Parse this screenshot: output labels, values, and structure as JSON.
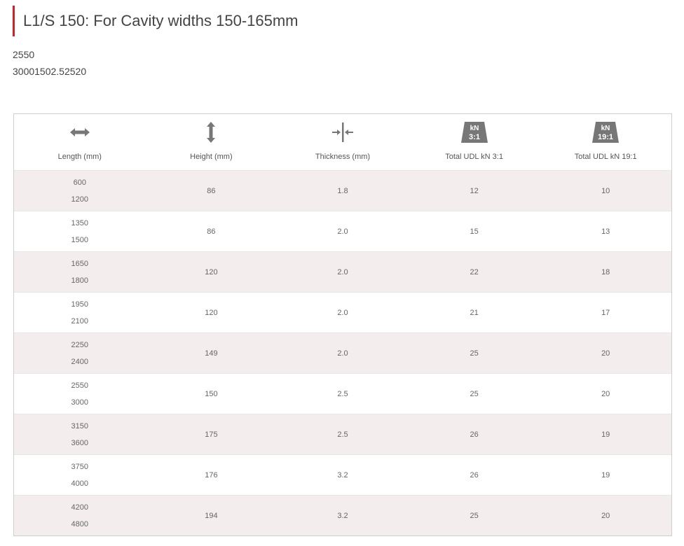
{
  "header": {
    "title": "L1/S 150: For Cavity widths 150-165mm",
    "meta_line_1": "2550",
    "meta_line_2": "30001502.52520"
  },
  "table": {
    "columns": [
      {
        "label": "Length (mm)",
        "icon": "horizontal-arrows-icon"
      },
      {
        "label": "Height (mm)",
        "icon": "vertical-arrows-icon"
      },
      {
        "label": "Thickness (mm)",
        "icon": "thickness-icon"
      },
      {
        "label": "Total UDL kN 3:1",
        "icon": "load-badge-icon",
        "badge_top": "kN",
        "badge_bottom": "3:1"
      },
      {
        "label": "Total UDL kN 19:1",
        "icon": "load-badge-icon",
        "badge_top": "kN",
        "badge_bottom": "19:1"
      }
    ],
    "rows": [
      {
        "length_a": "600",
        "length_b": "1200",
        "height": "86",
        "thickness": "1.8",
        "udl_3_1": "12",
        "udl_19_1": "10"
      },
      {
        "length_a": "1350",
        "length_b": "1500",
        "height": "86",
        "thickness": "2.0",
        "udl_3_1": "15",
        "udl_19_1": "13"
      },
      {
        "length_a": "1650",
        "length_b": "1800",
        "height": "120",
        "thickness": "2.0",
        "udl_3_1": "22",
        "udl_19_1": "18"
      },
      {
        "length_a": "1950",
        "length_b": "2100",
        "height": "120",
        "thickness": "2.0",
        "udl_3_1": "21",
        "udl_19_1": "17"
      },
      {
        "length_a": "2250",
        "length_b": "2400",
        "height": "149",
        "thickness": "2.0",
        "udl_3_1": "25",
        "udl_19_1": "20"
      },
      {
        "length_a": "2550",
        "length_b": "3000",
        "height": "150",
        "thickness": "2.5",
        "udl_3_1": "25",
        "udl_19_1": "20"
      },
      {
        "length_a": "3150",
        "length_b": "3600",
        "height": "175",
        "thickness": "2.5",
        "udl_3_1": "26",
        "udl_19_1": "19"
      },
      {
        "length_a": "3750",
        "length_b": "4000",
        "height": "176",
        "thickness": "3.2",
        "udl_3_1": "26",
        "udl_19_1": "19"
      },
      {
        "length_a": "4200",
        "length_b": "4800",
        "height": "194",
        "thickness": "3.2",
        "udl_3_1": "25",
        "udl_19_1": "20"
      }
    ]
  },
  "colors": {
    "accent": "#cc2229",
    "stripe": "#f3eded",
    "icon": "#777777"
  }
}
